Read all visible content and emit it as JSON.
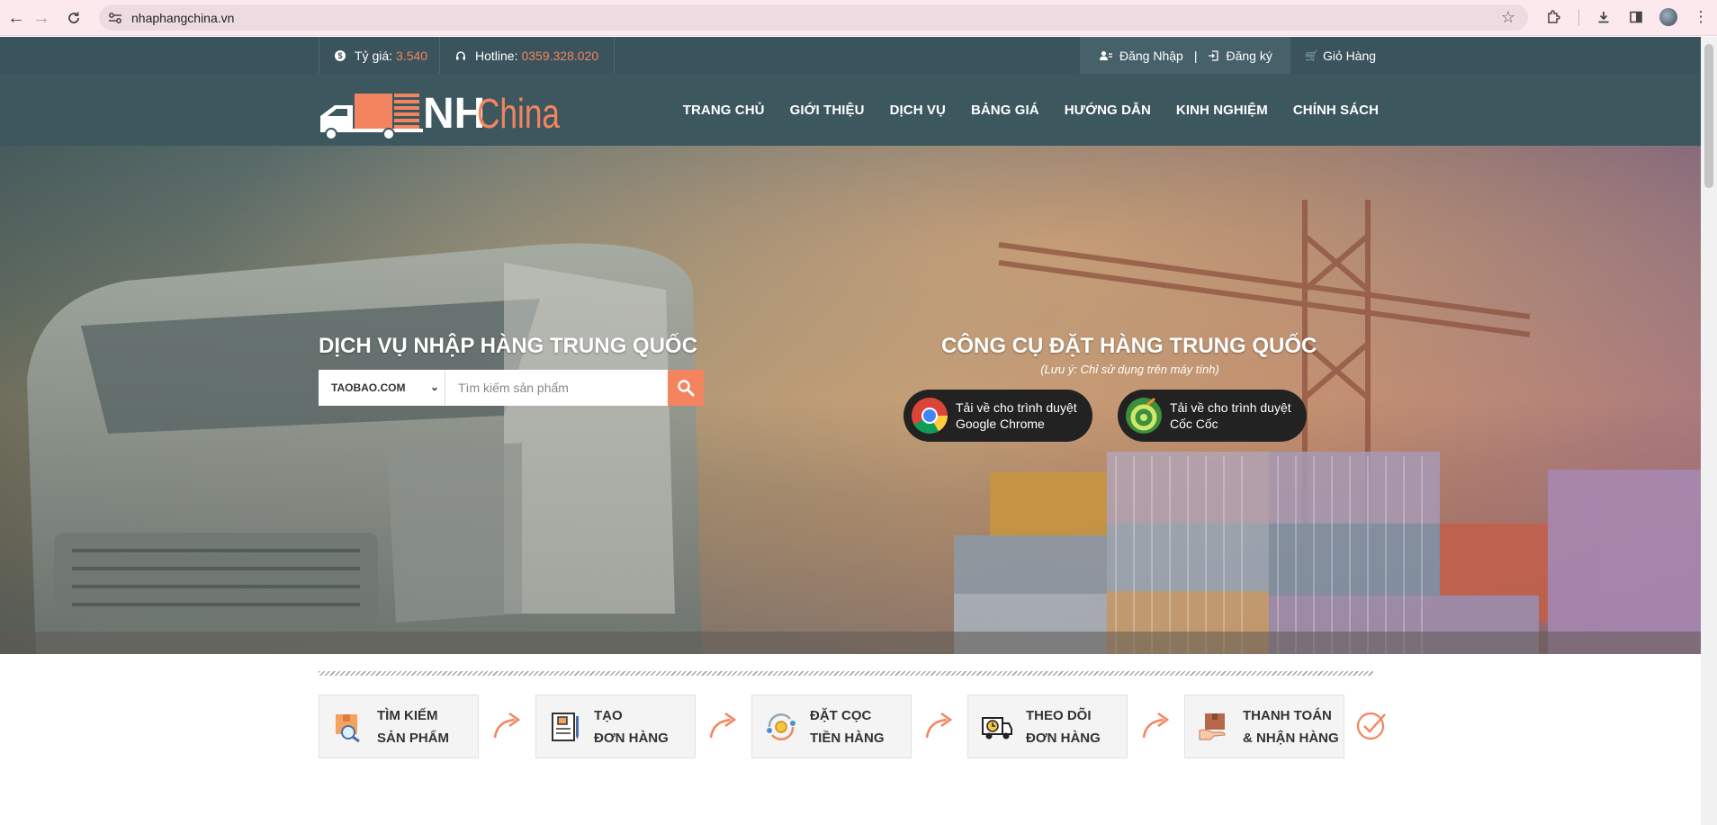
{
  "browser": {
    "url": "nhaphangchina.vn"
  },
  "topbar": {
    "rate_label": "Tỷ giá:",
    "rate_value": "3.540",
    "hotline_label": "Hotline:",
    "hotline_value": "0359.328.020",
    "login": "Đăng Nhập",
    "divider": "|",
    "register": "Đăng ký",
    "cart": "Giỏ Hàng"
  },
  "logo": {
    "text_nh": "NH",
    "text_china": "China"
  },
  "nav": {
    "items": [
      "TRANG CHỦ",
      "GIỚI THIỆU",
      "DỊCH VỤ",
      "BẢNG GIÁ",
      "HƯỚNG DẪN",
      "KINH NGHIỆM",
      "CHÍNH SÁCH"
    ]
  },
  "hero": {
    "left_title": "DỊCH VỤ NHẬP HÀNG TRUNG QUỐC",
    "site_selected": "TAOBAO.COM",
    "search_placeholder": "Tìm kiếm sản phẩm",
    "right_title": "CÔNG CỤ ĐẶT HÀNG TRUNG QUỐC",
    "note": "(Lưu ý: Chỉ sử dụng trên máy tính)",
    "chrome_line1": "Tải về cho trình duyệt",
    "chrome_line2": "Google Chrome",
    "coccoc_line1": "Tải về cho trình duyệt",
    "coccoc_line2": "Cốc Cốc"
  },
  "steps": [
    {
      "line1": "TÌM KIẾM",
      "line2": "SẢN PHẨM"
    },
    {
      "line1": "TẠO",
      "line2": "ĐƠN HÀNG"
    },
    {
      "line1": "ĐẶT CỌC",
      "line2": "TIỀN HÀNG"
    },
    {
      "line1": "THEO DÕI",
      "line2": "ĐƠN HÀNG"
    },
    {
      "line1": "THANH TOÁN",
      "line2": "& NHẬN HÀNG"
    }
  ],
  "colors": {
    "accent": "#f4845f",
    "topbar_bg": "#3a535c",
    "header_bg": "#3d575f"
  }
}
